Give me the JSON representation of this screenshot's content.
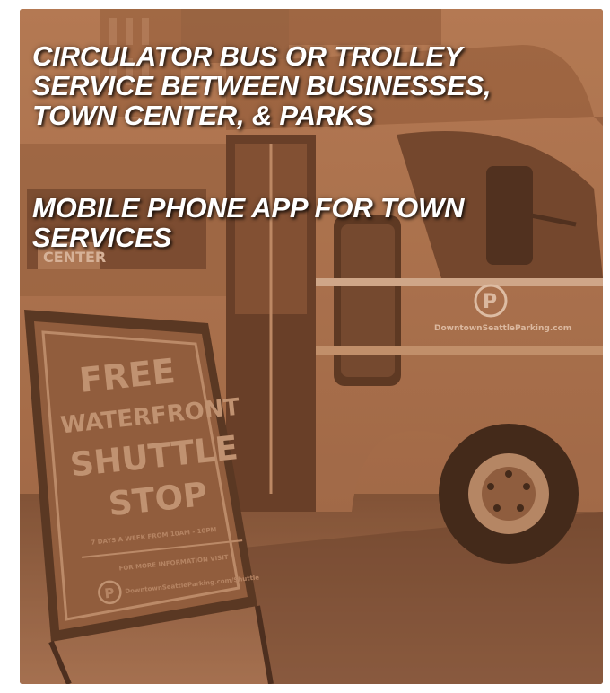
{
  "headline_1": "CIRCULATOR BUS OR TROLLEY SERVICE BETWEEN BUSINESSES, TOWN CENTER, & PARKS",
  "headline_2": "MOBILE PHONE APP FOR TOWN SERVICES",
  "sign": {
    "line1": "FREE",
    "line2": "WATERFRONT",
    "line3": "SHUTTLE",
    "line4": "STOP",
    "schedule": "7 DAYS A WEEK FROM 10AM - 10PM",
    "more_info": "FOR MORE INFORMATION VISIT",
    "url": "DowntownSeattleParking.com/Shuttle",
    "logo_letter": "P"
  },
  "bus": {
    "logo_letter": "P",
    "side_text": "DowntownSeattleParking.com",
    "dest_text": "CENTER"
  },
  "colors": {
    "tint": "#a86d48",
    "headline": "#ffffff"
  }
}
